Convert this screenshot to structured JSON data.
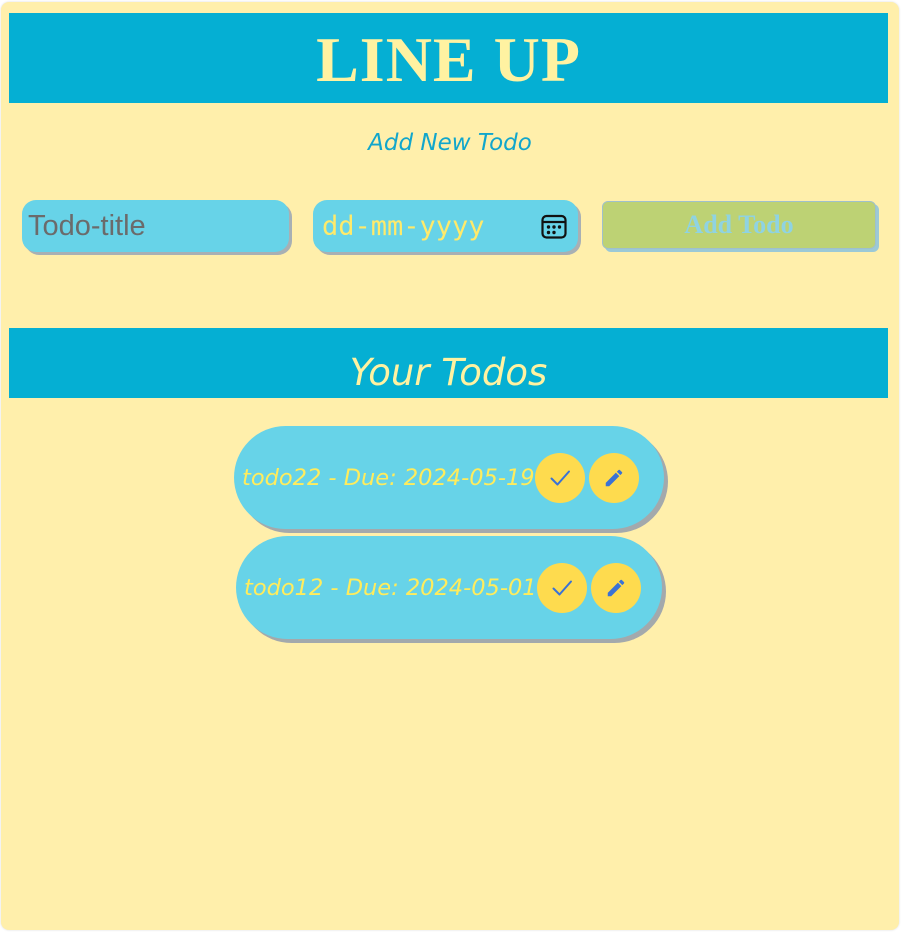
{
  "app": {
    "title": "LINE UP"
  },
  "add_section": {
    "heading": "Add New Todo",
    "title_placeholder": "Todo-title",
    "date_placeholder": "dd-mm-yyyy",
    "add_button_label": "Add Todo"
  },
  "todos_section": {
    "heading": "Your Todos",
    "items": [
      {
        "text": "todo22 - Due: 2024-05-19",
        "complete_icon": "check-icon",
        "edit_icon": "pencil-icon"
      },
      {
        "text": "todo12 - Due: 2024-05-01",
        "complete_icon": "check-icon",
        "edit_icon": "pencil-icon"
      }
    ]
  },
  "colors": {
    "background": "#ffefab",
    "header_bar": "#05afd3",
    "title_text": "#fff2a1",
    "input_fill": "#67d3e8",
    "button_fill": "#bdd274",
    "action_button": "#fedb4e",
    "icon_color": "#3a72d6"
  }
}
